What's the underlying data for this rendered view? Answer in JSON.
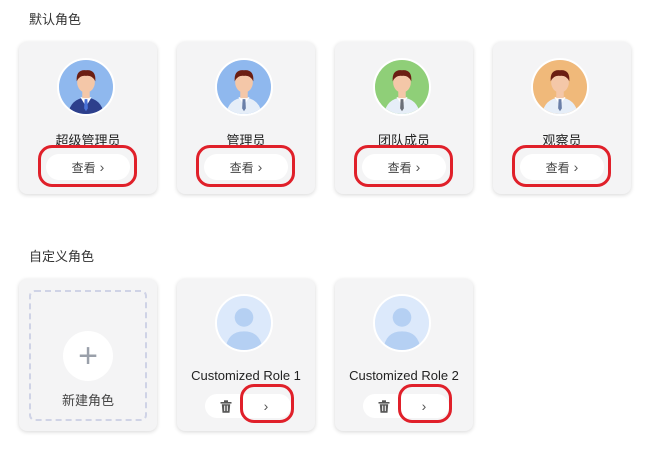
{
  "default_roles": {
    "title": "默认角色",
    "view_label": "查看",
    "chevron": "›",
    "cards": [
      {
        "name": "超级管理员",
        "avatar_icon": "super-admin-avatar-icon",
        "avatar_bg": "#8fb8ee"
      },
      {
        "name": "管理员",
        "avatar_icon": "admin-avatar-icon",
        "avatar_bg": "#8fb8ee"
      },
      {
        "name": "团队成员",
        "avatar_icon": "team-member-avatar-icon",
        "avatar_bg": "#8fcf78"
      },
      {
        "name": "观察员",
        "avatar_icon": "observer-avatar-icon",
        "avatar_bg": "#f0b97a"
      }
    ]
  },
  "custom_roles": {
    "title": "自定义角色",
    "new_role_label": "新建角色",
    "plus": "+",
    "chevron": "›",
    "cards": [
      {
        "name": "Customized Role 1",
        "avatar_icon": "default-user-avatar-icon"
      },
      {
        "name": "Customized Role 2",
        "avatar_icon": "default-user-avatar-icon"
      }
    ]
  },
  "colors": {
    "highlight": "#e0202a",
    "card_bg": "#f4f4f5",
    "default_avatar_bg": "#dce9fb"
  }
}
